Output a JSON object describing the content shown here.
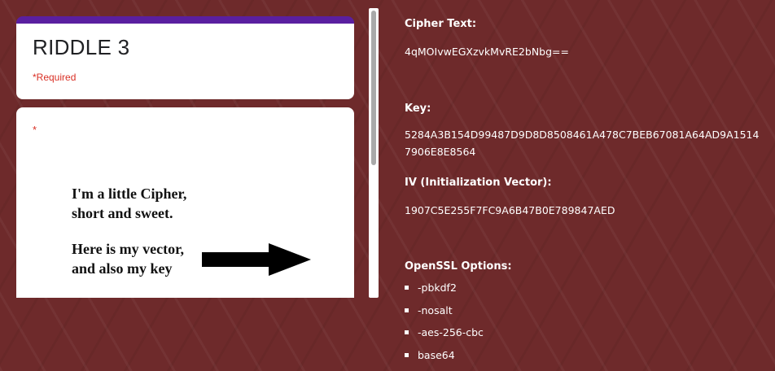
{
  "form": {
    "title": "RIDDLE 3",
    "required_note": "*Required",
    "question_asterisk": "*",
    "riddle_lines": [
      "I'm a little Cipher,",
      "short and sweet.",
      "Here is my vector,",
      "and also my key"
    ],
    "accent_color": "#5a1fa0"
  },
  "info": {
    "cipher_heading": "Cipher Text:",
    "cipher_value": "4qMOIvwEGXzvkMvRE2bNbg==",
    "key_heading": "Key:",
    "key_value": "5284A3B154D99487D9D8D8508461A478C7BEB67081A64AD9A15147906E8E8564",
    "iv_heading": "IV (Initialization Vector):",
    "iv_value": "1907C5E255F7FC9A6B47B0E789847AED",
    "openssl_heading": "OpenSSL Options:",
    "openssl_options": [
      "-pbkdf2",
      "-nosalt",
      "-aes-256-cbc",
      "base64"
    ]
  },
  "colors": {
    "background": "#6e2a2b",
    "required": "#d93025"
  }
}
